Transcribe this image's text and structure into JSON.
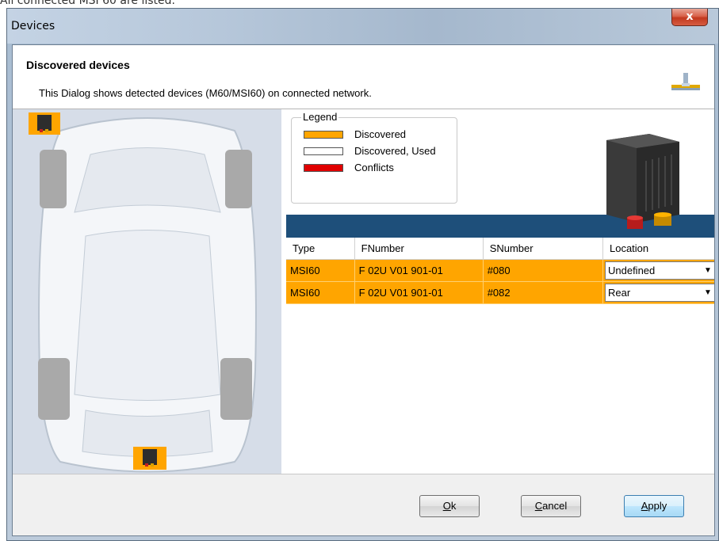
{
  "caption": "All connected MSI 60 are listed.",
  "window": {
    "title": "Devices",
    "close_glyph": "x"
  },
  "header": {
    "title": "Discovered devices",
    "subtitle": "This Dialog shows detected devices (M60/MSI60) on connected network.",
    "icon": "network-icon"
  },
  "legend": {
    "title": "Legend",
    "items": [
      {
        "label": "Discovered",
        "color": "#ffa500"
      },
      {
        "label": "Discovered, Used",
        "color": "#ffffff"
      },
      {
        "label": "Conflicts",
        "color": "#e00000"
      }
    ]
  },
  "table": {
    "columns": [
      "Type",
      "FNumber",
      "SNumber",
      "Location"
    ],
    "rows": [
      {
        "type": "MSI60",
        "fnumber": "F 02U V01 901-01",
        "snumber": "#080",
        "location": "Undefined"
      },
      {
        "type": "MSI60",
        "fnumber": "F 02U V01 901-01",
        "snumber": "#082",
        "location": "Rear"
      }
    ],
    "row_color": "#ffa500"
  },
  "buttons": {
    "ok": {
      "mnemonic": "O",
      "rest": "k"
    },
    "cancel": {
      "mnemonic": "C",
      "rest": "ancel"
    },
    "apply": {
      "mnemonic": "A",
      "rest": "pply"
    }
  },
  "colors": {
    "accent_bar": "#1e4f7a",
    "discovered": "#ffa500"
  }
}
